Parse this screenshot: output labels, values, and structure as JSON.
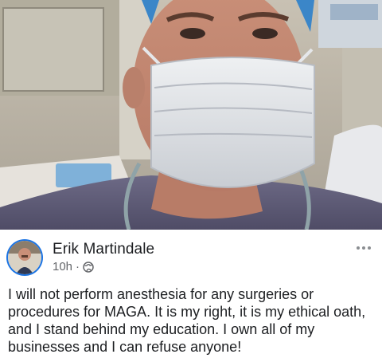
{
  "post": {
    "author": "Erik Martindale",
    "time": "10h",
    "separator": "·",
    "privacy_icon": "globe-icon",
    "more_icon": "more-options-icon",
    "text": "I will not perform anesthesia for any surgeries or procedures for MAGA. It is my right, it is my ethical oath, and I stand behind my education. I own all of my businesses and I can refuse anyone!"
  },
  "colors": {
    "accent": "#1b74e4",
    "text": "#1c1e21",
    "muted": "#65676b"
  }
}
